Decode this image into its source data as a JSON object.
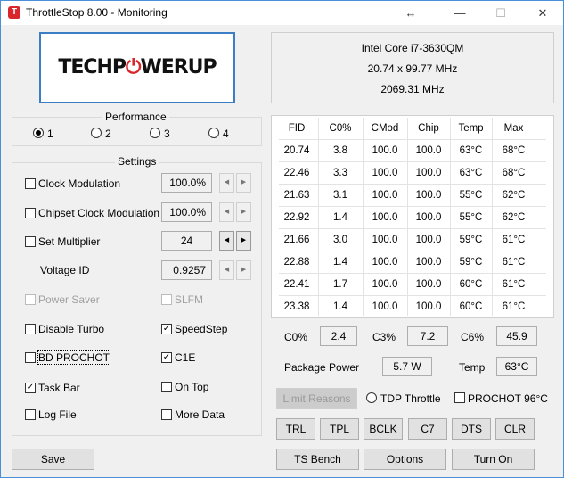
{
  "window": {
    "title": "ThrottleStop 8.00 - Monitoring",
    "icon_letter": "T",
    "controls": {
      "move": "↔",
      "minimize": "—",
      "maximize": "☐",
      "close": "✕"
    }
  },
  "logo": {
    "part1": "TECHP",
    "part2": "⏻",
    "part3": "WERUP"
  },
  "cpu": {
    "name": "Intel Core i7-3630QM",
    "multiplier": "20.74 x 99.77 MHz",
    "speed": "2069.31 MHz"
  },
  "performance": {
    "title": "Performance",
    "options": [
      "1",
      "2",
      "3",
      "4"
    ],
    "selected": 0
  },
  "settings": {
    "title": "Settings",
    "clock_modulation": {
      "label": "Clock Modulation",
      "value": "100.0%"
    },
    "chipset_clock_modulation": {
      "label": "Chipset Clock Modulation",
      "value": "100.0%"
    },
    "set_multiplier": {
      "label": "Set Multiplier",
      "value": "24"
    },
    "voltage_id": {
      "label": "Voltage ID",
      "value": "0.9257"
    },
    "power_saver": "Power Saver",
    "slfm": "SLFM",
    "disable_turbo": "Disable Turbo",
    "speedstep": "SpeedStep",
    "bd_prochot": "BD PROCHOT",
    "c1e": "C1E",
    "task_bar": "Task Bar",
    "on_top": "On Top",
    "log_file": "Log File",
    "more_data": "More Data",
    "spin_left": "◀",
    "spin_right": "▶",
    "check_mark": "✓"
  },
  "table": {
    "headers": [
      "FID",
      "C0%",
      "CMod",
      "Chip",
      "Temp",
      "Max"
    ],
    "rows": [
      [
        "20.74",
        "3.8",
        "100.0",
        "100.0",
        "63°C",
        "68°C"
      ],
      [
        "22.46",
        "3.3",
        "100.0",
        "100.0",
        "63°C",
        "68°C"
      ],
      [
        "21.63",
        "3.1",
        "100.0",
        "100.0",
        "55°C",
        "62°C"
      ],
      [
        "22.92",
        "1.4",
        "100.0",
        "100.0",
        "55°C",
        "62°C"
      ],
      [
        "21.66",
        "3.0",
        "100.0",
        "100.0",
        "59°C",
        "61°C"
      ],
      [
        "22.88",
        "1.4",
        "100.0",
        "100.0",
        "59°C",
        "61°C"
      ],
      [
        "22.41",
        "1.7",
        "100.0",
        "100.0",
        "60°C",
        "61°C"
      ],
      [
        "23.38",
        "1.4",
        "100.0",
        "100.0",
        "60°C",
        "61°C"
      ]
    ]
  },
  "stats": {
    "c0_label": "C0%",
    "c0_value": "2.4",
    "c3_label": "C3%",
    "c3_value": "7.2",
    "c6_label": "C6%",
    "c6_value": "45.9",
    "package_power_label": "Package Power",
    "package_power_value": "5.7 W",
    "temp_label": "Temp",
    "temp_value": "63°C"
  },
  "limits": {
    "limit_reasons": "Limit Reasons",
    "tdp_throttle": "TDP Throttle",
    "prochot": "PROCHOT 96°C"
  },
  "buttons": {
    "trl": "TRL",
    "tpl": "TPL",
    "bclk": "BCLK",
    "c7": "C7",
    "dts": "DTS",
    "clr": "CLR",
    "save": "Save",
    "ts_bench": "TS Bench",
    "options": "Options",
    "turn_on": "Turn On"
  }
}
